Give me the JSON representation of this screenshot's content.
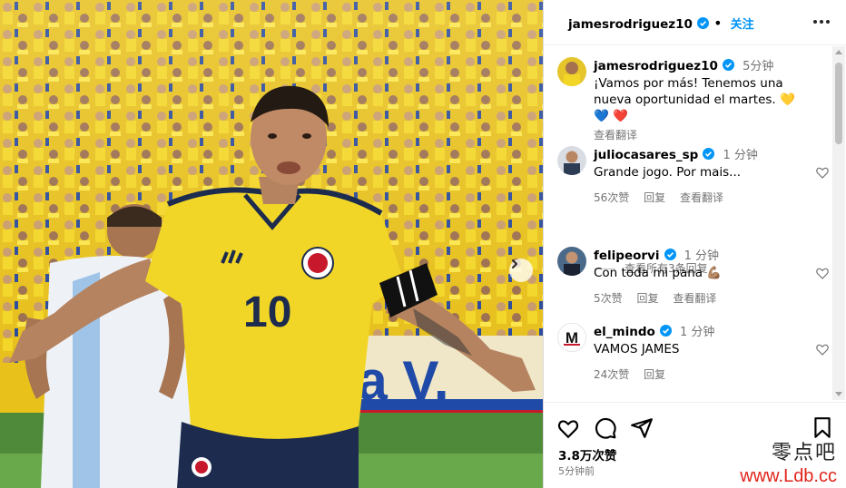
{
  "post": {
    "author": "jamesrodriguez10",
    "follow_label": "关注",
    "caption": {
      "username": "jamesrodriguez10",
      "time": "5分钟",
      "text": "¡Vamos por más! Tenemos una nueva oportunidad el martes. 💛 💙 ❤️",
      "translate_label": "查看翻译"
    },
    "jersey_number": "10",
    "banner_text": "ra V."
  },
  "comments": [
    {
      "username": "juliocasares_sp",
      "time": "1 分钟",
      "text": "Grande jogo. Por mais...",
      "likes": "56次赞",
      "reply_label": "回复",
      "translate_label": "查看翻译",
      "view_replies": "查看所有3条回复"
    },
    {
      "username": "felipeorvi",
      "time": "1 分钟",
      "text": "Con toda mi pana 💪🏽",
      "likes": "5次赞",
      "reply_label": "回复",
      "translate_label": "查看翻译"
    },
    {
      "username": "el_mindo",
      "time": "1 分钟",
      "text": "VAMOS JAMES",
      "likes": "24次赞",
      "reply_label": "回复"
    }
  ],
  "footer": {
    "likes_count": "3.8万次赞",
    "posted_time": "5分钟前"
  },
  "watermark": {
    "chinese": "零点吧",
    "url": "www.Ldb.cc"
  },
  "icons": [
    "verified-badge-icon",
    "more-options-icon",
    "heart-icon",
    "comment-icon",
    "share-icon",
    "bookmark-icon",
    "chevron-right-icon"
  ],
  "colors": {
    "accent": "#0095f6",
    "secondary_text": "#737373",
    "jersey_yellow": "#f2d627",
    "jersey_navy": "#1c2b4e",
    "watermark_red": "#e0231b"
  }
}
